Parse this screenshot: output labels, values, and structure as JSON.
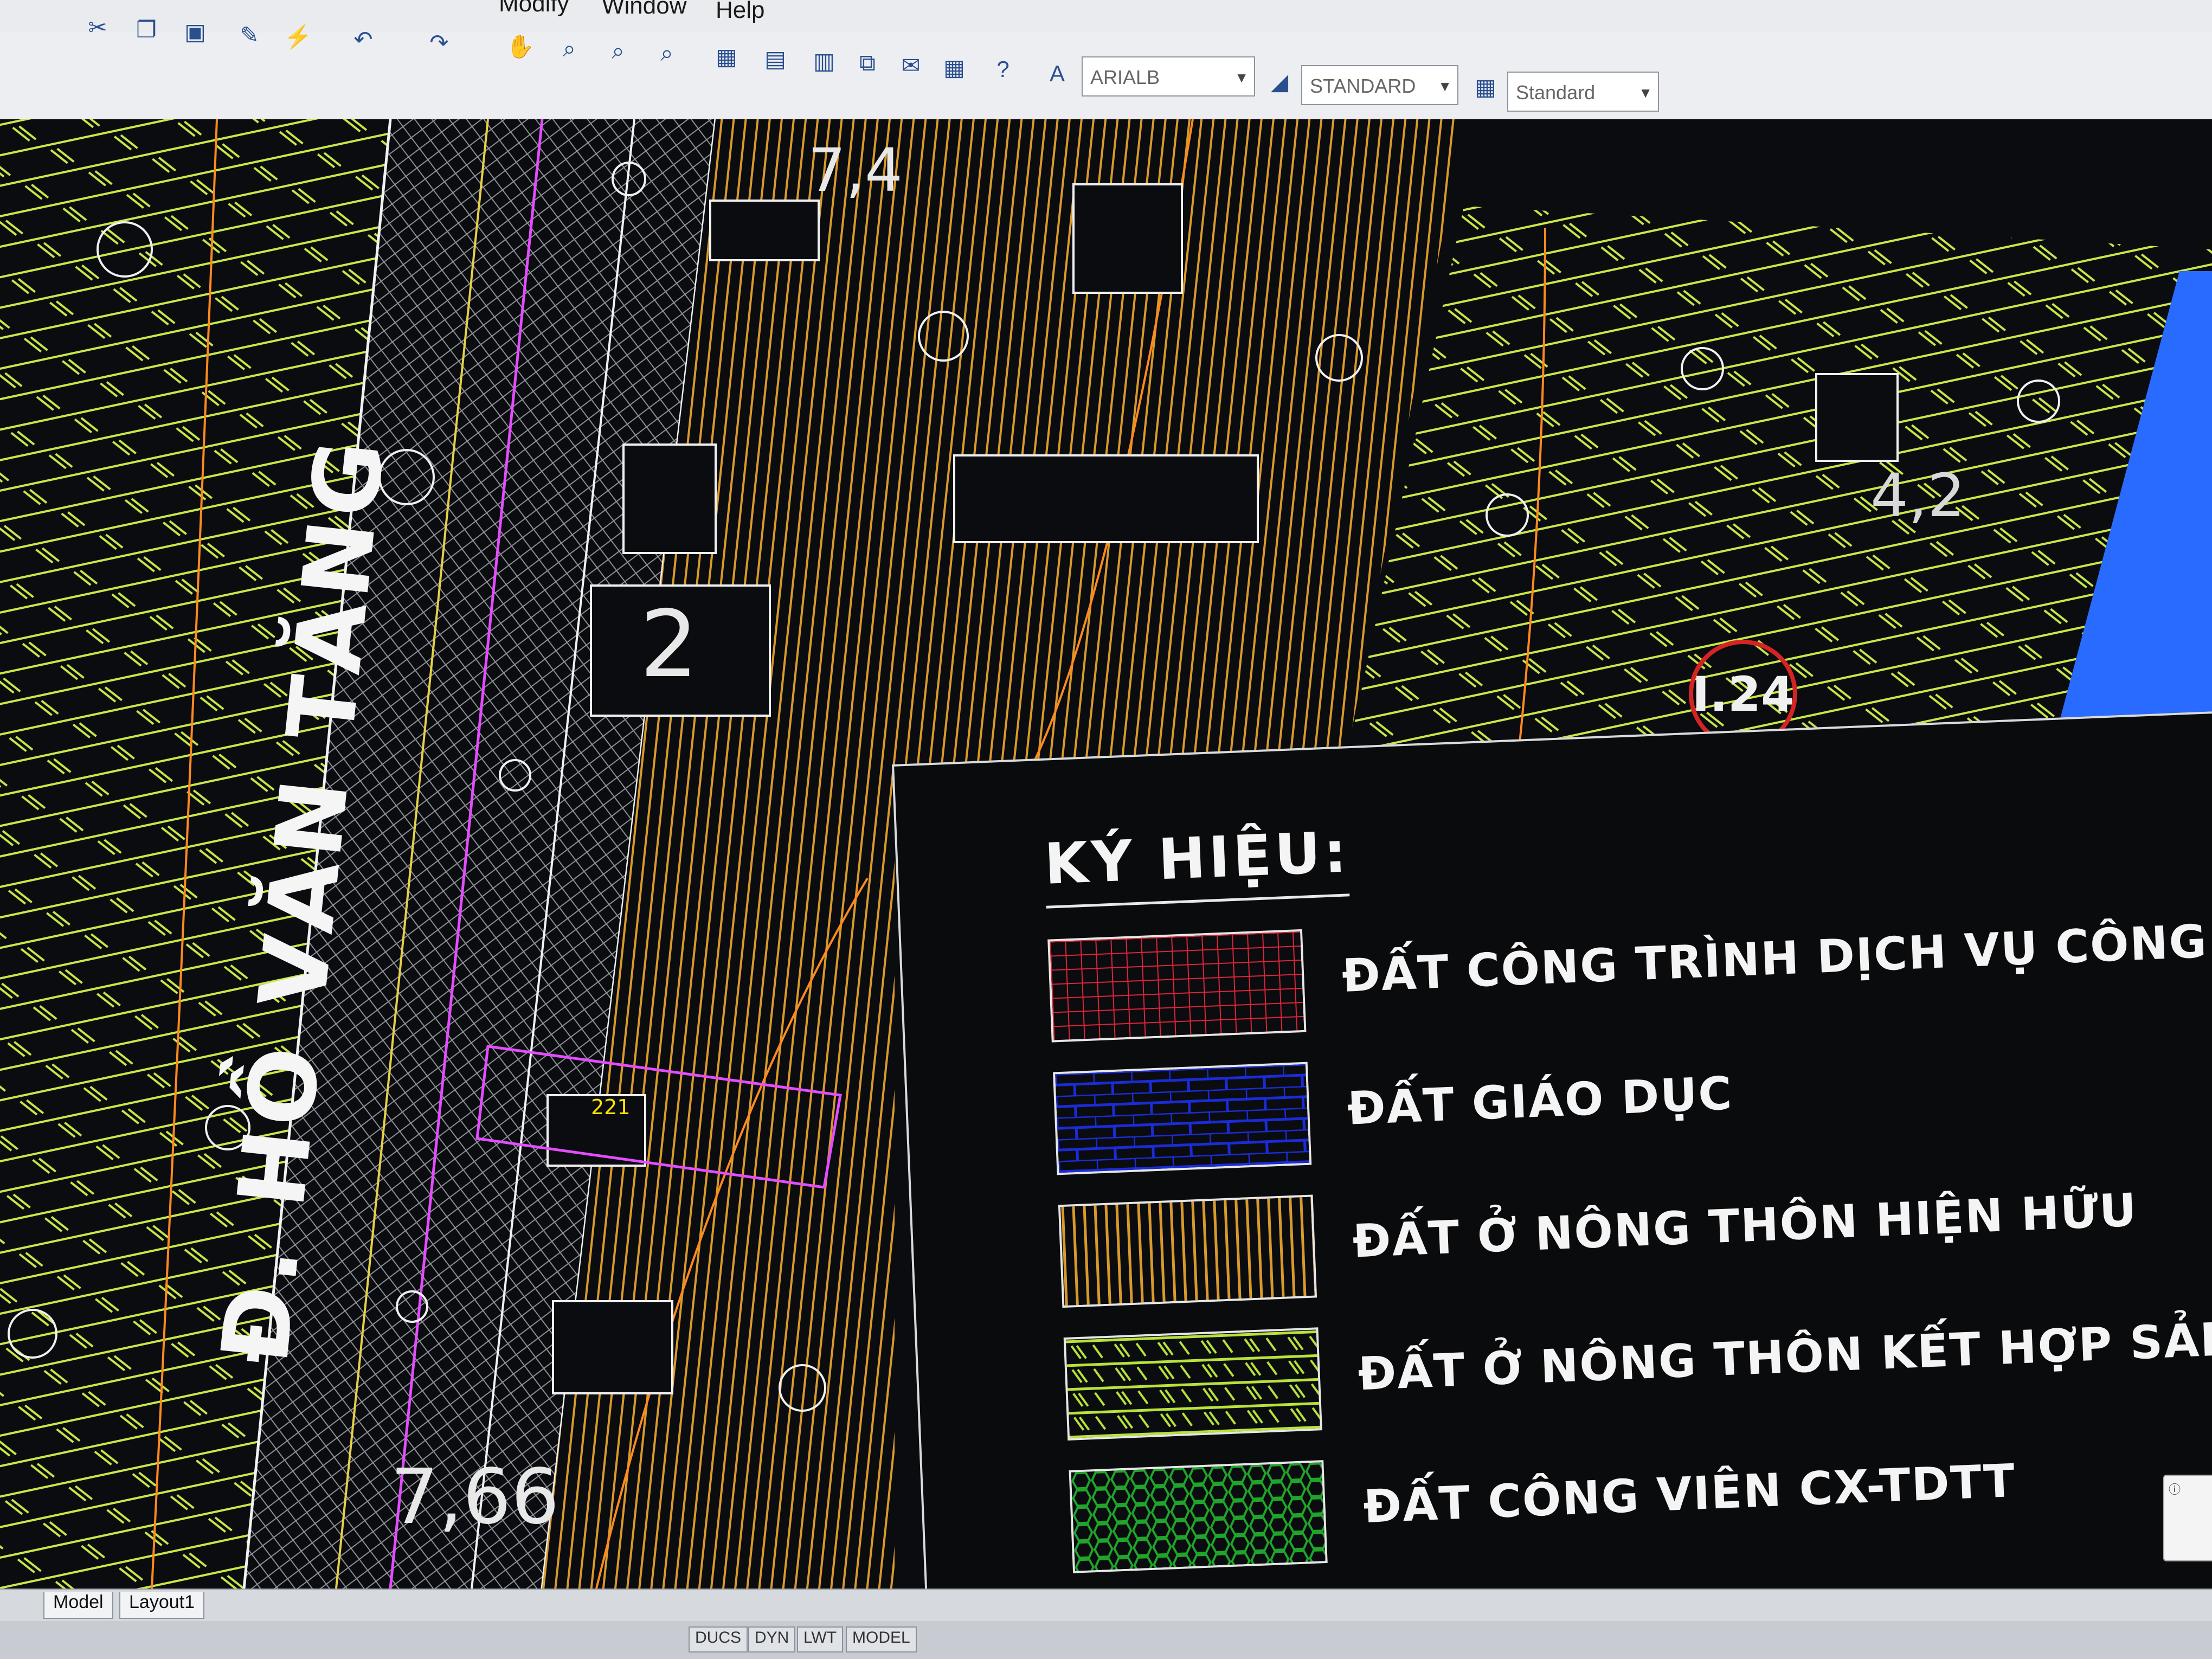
{
  "menu": {
    "items": [
      "Modify",
      "Window",
      "Help"
    ]
  },
  "toolbar": {
    "text_style": "ARIALB",
    "dim_style": "STANDARD",
    "table_style": "Standard",
    "icons": [
      "cut-icon",
      "copy-icon",
      "paste-icon",
      "match-properties-icon",
      "brush-icon",
      "undo-icon",
      "redo-icon",
      "pan-icon",
      "zoom-realtime-icon",
      "zoom-window-icon",
      "zoom-previous-icon",
      "properties-icon",
      "design-center-icon",
      "tool-palettes-icon",
      "sheet-set-icon",
      "markup-icon",
      "calculator-icon",
      "help-icon"
    ]
  },
  "map": {
    "road_label": "Đ. HỒ VĂN TĂNG",
    "lot_number": "2",
    "lot_code": "221",
    "dimension_top": "7,4",
    "dimension_bottom": "7,66",
    "dimension_right": "4,2",
    "callout_label": "I.24",
    "colors": {
      "background": "#0b0c0f",
      "residential_hatch": "#d99a2b",
      "farm_hatch": "#c7e84a",
      "road_hatch": "#cfd2d6",
      "boundary": "#e34dff",
      "contour": "#ff8a1f",
      "callout": "#d42424",
      "park": "#2a6bff"
    }
  },
  "legend": {
    "title": "KÝ HIỆU:",
    "items": [
      {
        "label": "ĐẤT CÔNG TRÌNH DỊCH VỤ CÔNG CỘNG",
        "color": "#e0233a",
        "pattern": "grid"
      },
      {
        "label": "ĐẤT GIÁO DỤC",
        "color": "#1a2bd8",
        "pattern": "brick"
      },
      {
        "label": "ĐẤT Ở NÔNG THÔN HIỆN HỮU",
        "color": "#d99a2b",
        "pattern": "vertical-lines"
      },
      {
        "label": "ĐẤT Ở NÔNG THÔN KẾT HỢP SẢN XUẤT",
        "color": "#b7e33a",
        "pattern": "horizontal-lines-ticks"
      },
      {
        "label": "ĐẤT CÔNG VIÊN CX-TDTT",
        "color": "#1fa62a",
        "pattern": "hexagon"
      }
    ]
  },
  "tabs": {
    "model": "Model",
    "layout": "Layout1"
  },
  "status": {
    "items": [
      "DUCS",
      "DYN",
      "LWT",
      "MODEL"
    ]
  }
}
